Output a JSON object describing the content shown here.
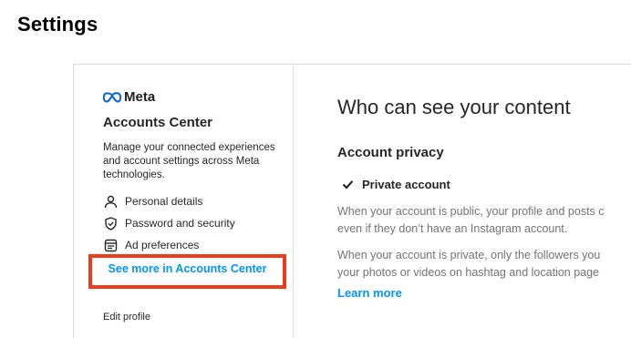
{
  "page": {
    "title": "Settings"
  },
  "accounts_center": {
    "brand": "Meta",
    "title": "Accounts Center",
    "description": "Manage your connected experiences and account settings across Meta technologies.",
    "items": [
      {
        "icon": "person-icon",
        "label": "Personal details"
      },
      {
        "icon": "shield-check-icon",
        "label": "Password and security"
      },
      {
        "icon": "ad-icon",
        "label": "Ad preferences"
      }
    ],
    "see_more": "See more in Accounts Center",
    "highlight_color": "#ee3b1a",
    "next_item_peek": "Edit profile"
  },
  "privacy": {
    "heading": "Who can see your content",
    "section": "Account privacy",
    "checkbox_label": "Private account",
    "checked": true,
    "public_text_line1": "When your account is public, your profile and posts c",
    "public_text_line2": "even if they don’t have an Instagram account.",
    "private_text_line1": "When your account is private, only the followers you",
    "private_text_line2": "your photos or videos on hashtag and location page",
    "learn_more": "Learn more"
  },
  "colors": {
    "link": "#0095f6",
    "text": "#262626",
    "muted": "#737373",
    "border": "#dbdbdb"
  }
}
